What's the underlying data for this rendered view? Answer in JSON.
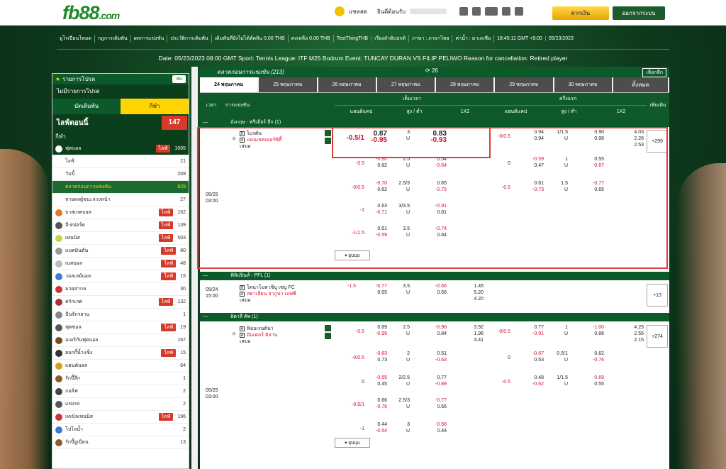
{
  "header": {
    "logo": "fb88",
    "logo_suffix": ".com",
    "chat_label": "แชทสด",
    "welcome_label": "ยินดีต้อนรับ",
    "deposit_button": "ฝากเงิน",
    "logout_button": "ออกจากระบบ"
  },
  "nav": {
    "items": [
      "ยูโรเปียนโหมด",
      "กฎการเดิมพัน",
      "ผลการแข่งขัน",
      "ประวัติการเดิมพัน",
      "เดิมพันที่ยังไม่ได้ตัดสิน 0.00 THB",
      "คงเหลือ 0.00 THB",
      "TestThingTHB",
      "เรียงลำดับปกติ",
      "ภาษา : ภาษาไทย",
      "ค่าน้ำ : มาเลเซีย",
      "18:45:11 GMT +8:00",
      "05/23/2023"
    ]
  },
  "banner": {
    "text": "Date: 05/23/2023 08:00 GMT Sport: Tennis League: ITF M25 Bodrum Event: TUNCAY DURAN VS FILIP PELIWO Reason for cancellation: Retired player"
  },
  "sidebar": {
    "favorites_title": "รายการโปรด",
    "clear_label": "ลบ",
    "no_favorites": "ไม่มีรายการโปรด",
    "tab_bets": "บัตเดิมพัน",
    "tab_sports": "กีฬา",
    "live_now": "ไลฟ์ตอนนี้",
    "live_count": "147",
    "sports_title": "กีฬา",
    "live_badge": "ไลฟ์",
    "football": {
      "label": "ฟุตบอล",
      "count": "1065"
    },
    "sub_items": [
      {
        "label": "ไลฟ์",
        "count": "21"
      },
      {
        "label": "วันนี้",
        "count": "209"
      },
      {
        "label": "ตลาดก่อนการแข่งขัน",
        "count": "829"
      },
      {
        "label": "ทายผลผู้ชนะล่วงหน้า",
        "count": "27"
      }
    ],
    "sports": [
      {
        "label": "บาสเกตบอล",
        "count": "162",
        "live": true,
        "color": "#e07a2a"
      },
      {
        "label": "อี-สปอร์ต",
        "count": "139",
        "live": true,
        "color": "#555"
      },
      {
        "label": "เทนนิส",
        "count": "503",
        "live": true,
        "color": "#c9d43a"
      },
      {
        "label": "แบดมินตัน",
        "count": "80",
        "live": true,
        "color": "#999"
      },
      {
        "label": "เบสบอล",
        "count": "48",
        "live": true,
        "color": "#bbb"
      },
      {
        "label": "วอลเลย์บอล",
        "count": "15",
        "live": true,
        "color": "#3a7bd5"
      },
      {
        "label": "มวยสากล",
        "count": "30",
        "live": false,
        "color": "#c33"
      },
      {
        "label": "คริกเกต",
        "count": "132",
        "live": true,
        "color": "#a33"
      },
      {
        "label": "ปั่นจักรยาน",
        "count": "1",
        "live": false,
        "color": "#888"
      },
      {
        "label": "ฟุตซอล",
        "count": "19",
        "live": true,
        "color": "#555"
      },
      {
        "label": "อเมริกันฟุตบอล",
        "count": "167",
        "live": false,
        "color": "#7a4a20"
      },
      {
        "label": "ฮอกกี้น้ำแข็ง",
        "count": "15",
        "live": true,
        "color": "#333"
      },
      {
        "label": "แฮนด์บอล",
        "count": "64",
        "live": false,
        "color": "#d4a017"
      },
      {
        "label": "รักบี้ลีก",
        "count": "1",
        "live": false,
        "color": "#8a5a2a"
      },
      {
        "label": "กอล์ฟ",
        "count": "2",
        "live": false,
        "color": "#444"
      },
      {
        "label": "แข่งรถ",
        "count": "2",
        "live": false,
        "color": "#555"
      },
      {
        "label": "เทเบิลเทนนิส",
        "count": "196",
        "live": true,
        "color": "#c33"
      },
      {
        "label": "โปโลน้ำ",
        "count": "2",
        "live": false,
        "color": "#3a7bd5"
      },
      {
        "label": "รักบี้ยูเนี่ยน",
        "count": "13",
        "live": false,
        "color": "#8a5a2a"
      }
    ]
  },
  "main": {
    "title": "ตลาดก่อนการแข่งขัน (213)",
    "refresh_count": "26",
    "pick_label": "เลือกลีก",
    "dates": [
      "24 พฤษภาคม",
      "25 พฤษภาคม",
      "26 พฤษภาคม",
      "27 พฤษภาคม",
      "28 พฤษภาคม",
      "29 พฤษภาคม",
      "30 พฤษภาคม",
      "ทั้งหมด"
    ],
    "col_time": "เวลา",
    "col_match": "การแข่งขัน",
    "full_time": "เต็มเวลา",
    "first_half": "ครึ่งแรก",
    "handicap": "แฮนดิแคป",
    "over_under": "สูง / ต่ำ",
    "x12": "1X2",
    "more_bets": "เพิ่มเติม",
    "collapse": "ยุบมุม",
    "u": "U",
    "leagues": [
      {
        "name": "อังกฤษ - พรีเมียร์ ลีก (1)"
      },
      {
        "name": "ฟิลิปปินส์ - PFL (1)"
      },
      {
        "name": "อิตาลี คัพ (1)"
      }
    ],
    "match1": {
      "date": "05/25",
      "time": "03:00",
      "home": "ไบรตัน",
      "away": "แมนเชสเตอร์ซิตี้",
      "draw": "เสมอ",
      "more": "+299",
      "rows": [
        {
          "hdp": "-0.5/1",
          "h": "0.87",
          "a": "-0.95",
          "ou": "3",
          "o": "0.83",
          "u": "-0.93",
          "x": [
            "",
            "",
            ""
          ],
          "fh_hdp": "-0/0.5",
          "fh_h": "0.94",
          "fh_a": "0.94",
          "fh_ou": "1/1.5",
          "fh_o": "0.90",
          "fh_u": "0.98",
          "fh_x": [
            "4.03",
            "2.26",
            "2.53"
          ]
        },
        {
          "hdp": "-0.5",
          "h": "-0.90",
          "a": "0.82",
          "ou": "2.5",
          "o": "0.54",
          "u": "-0.64",
          "fh_hdp": "0",
          "fh_h": "-0.59",
          "fh_a": "0.47",
          "fh_ou": "1",
          "fh_o": "0.55",
          "fh_u": "-0.67"
        },
        {
          "hdp": "-0/0.5",
          "h": "-0.70",
          "a": "0.62",
          "ou": "2.5/3",
          "o": "0.65",
          "u": "-0.75",
          "fh_hdp": "-0.5",
          "fh_h": "0.61",
          "fh_a": "-0.73",
          "fh_ou": "1.5",
          "fh_o": "-0.77",
          "fh_u": "0.65"
        },
        {
          "hdp": "-1",
          "h": "0.63",
          "a": "-0.71",
          "ou": "3/3.5",
          "o": "-0.91",
          "u": "0.81"
        },
        {
          "hdp": "-1/1.5",
          "h": "0.51",
          "a": "-0.59",
          "ou": "3.5",
          "o": "-0.74",
          "u": "0.64"
        }
      ]
    },
    "match2": {
      "date": "05/24",
      "time": "15:00",
      "home": "ไดนาโมส เซ็บู เซบู FC",
      "away": "สตาเลียน ลากูนา เอฟซี",
      "draw": "เสมอ",
      "more": "+13",
      "hdp": "-1.5",
      "h": "-0.77",
      "a": "0.55",
      "ou": "3.5",
      "o": "-0.66",
      "u": "0.56",
      "x": [
        "1.45",
        "5.20",
        "4.20"
      ]
    },
    "match3": {
      "date": "05/25",
      "time": "03:00",
      "home": "ฟิออเรนติน่า",
      "away": "อินเตอร์ มิลาน",
      "draw": "เสมอ",
      "more": "+274",
      "rows": [
        {
          "hdp": "-0.5",
          "h": "0.89",
          "a": "-0.99",
          "ou": "2.5",
          "o": "-0.96",
          "u": "0.84",
          "x": [
            "3.92",
            "1.96",
            "3.41"
          ],
          "fh_hdp": "-0/0.5",
          "fh_h": "0.77",
          "fh_a": "-0.91",
          "fh_ou": "1",
          "fh_o": "-1.00",
          "fh_u": "0.86",
          "fh_x": [
            "4.25",
            "2.55",
            "2.15"
          ]
        },
        {
          "hdp": "-0/0.5",
          "h": "-0.83",
          "a": "0.73",
          "ou": "2",
          "o": "0.51",
          "u": "-0.63",
          "fh_hdp": "0",
          "fh_h": "-0.67",
          "fh_a": "0.53",
          "fh_ou": "0.5/1",
          "fh_o": "0.62",
          "fh_u": "-0.76"
        },
        {
          "hdp": "0",
          "h": "-0.55",
          "a": "0.45",
          "ou": "2/2.5",
          "o": "0.77",
          "u": "-0.89",
          "fh_hdp": "-0.5",
          "fh_h": "0.48",
          "fh_a": "-0.62",
          "fh_ou": "1/1.5",
          "fh_o": "-0.69",
          "fh_u": "0.55"
        },
        {
          "hdp": "-0.5/1",
          "h": "0.66",
          "a": "-0.76",
          "ou": "2.5/3",
          "o": "-0.77",
          "u": "0.65"
        },
        {
          "hdp": "-1",
          "h": "0.44",
          "a": "-0.54",
          "ou": "3",
          "o": "-0.56",
          "u": "0.44"
        }
      ]
    }
  }
}
